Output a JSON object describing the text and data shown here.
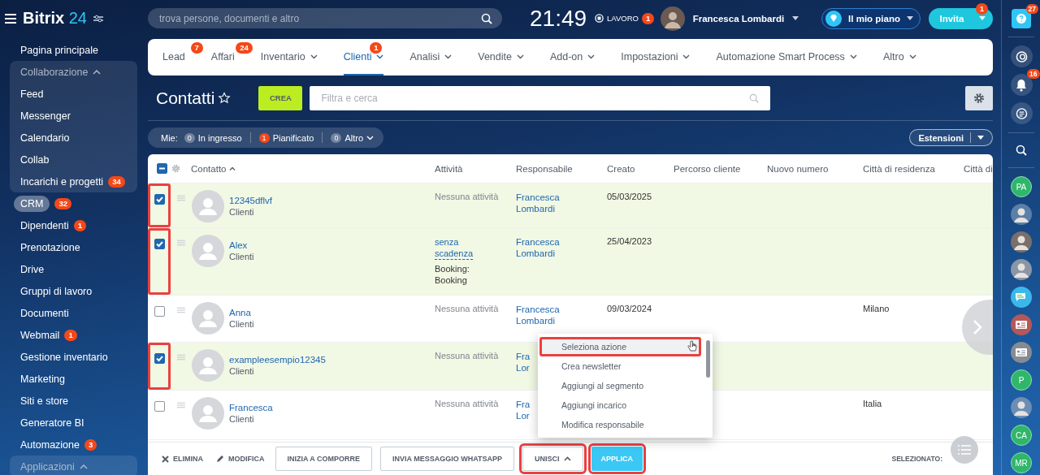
{
  "header": {
    "logo_name": "Bitrix",
    "logo_number": "24",
    "search_placeholder": "trova persone, documenti e altro",
    "clock": "21:49",
    "work_status": "LAVORO",
    "work_badge": "1",
    "user_name": "Francesca Lombardi",
    "plan_button": "Il mio piano",
    "invite_button": "Invita",
    "invite_badge": "1"
  },
  "sidebar": {
    "items": [
      {
        "kind": "link",
        "label": "Pagina principale",
        "selected": false
      },
      {
        "kind": "group",
        "label": "Collaborazione",
        "expanded": true,
        "children": [
          {
            "label": "Feed",
            "selected": false
          },
          {
            "label": "Messenger",
            "selected": false
          },
          {
            "label": "Calendario",
            "selected": false
          },
          {
            "label": "Collab",
            "selected": false
          },
          {
            "label": "Incarichi e progetti",
            "badge": "34",
            "selected": false
          }
        ]
      },
      {
        "kind": "link",
        "label": "CRM",
        "badge": "32",
        "selected": true
      },
      {
        "kind": "link",
        "label": "Dipendenti",
        "badge": "1",
        "selected": false
      },
      {
        "kind": "link",
        "label": "Prenotazione",
        "selected": false
      },
      {
        "kind": "link",
        "label": "Drive",
        "selected": false
      },
      {
        "kind": "link",
        "label": "Gruppi di lavoro",
        "selected": false
      },
      {
        "kind": "link",
        "label": "Documenti",
        "selected": false
      },
      {
        "kind": "link",
        "label": "Webmail",
        "badge": "1",
        "selected": false
      },
      {
        "kind": "link",
        "label": "Gestione inventario",
        "selected": false
      },
      {
        "kind": "link",
        "label": "Marketing",
        "selected": false
      },
      {
        "kind": "link",
        "label": "Siti e store",
        "selected": false
      },
      {
        "kind": "link",
        "label": "Generatore BI",
        "selected": false
      },
      {
        "kind": "link",
        "label": "Automazione",
        "badge": "3",
        "selected": false
      },
      {
        "kind": "group",
        "label": "Applicazioni",
        "expanded": true
      }
    ]
  },
  "nav_tabs": [
    {
      "label": "Lead",
      "badge": "7",
      "dropdown": false,
      "selected": false
    },
    {
      "label": "Affari",
      "badge": "24",
      "dropdown": false,
      "selected": false
    },
    {
      "label": "Inventario",
      "dropdown": true,
      "selected": false
    },
    {
      "label": "Clienti",
      "badge": "1",
      "dropdown": true,
      "selected": true
    },
    {
      "label": "Analisi",
      "dropdown": true,
      "selected": false
    },
    {
      "label": "Vendite",
      "dropdown": true,
      "selected": false
    },
    {
      "label": "Add-on",
      "dropdown": true,
      "selected": false
    },
    {
      "label": "Impostazioni",
      "dropdown": true,
      "selected": false
    },
    {
      "label": "Automazione Smart Process",
      "dropdown": true,
      "selected": false
    },
    {
      "label": "Altro",
      "dropdown": true,
      "selected": false
    }
  ],
  "page": {
    "title": "Contatti",
    "create_button": "CREA",
    "filter_placeholder": "Filtra e cerca"
  },
  "counters": {
    "label": "Mie:",
    "items": [
      {
        "count": "0",
        "label": "In ingresso",
        "alert": false,
        "dropdown": false
      },
      {
        "count": "1",
        "label": "Pianificato",
        "alert": true,
        "dropdown": false
      },
      {
        "count": "0",
        "label": "Altro",
        "alert": false,
        "dropdown": true
      }
    ],
    "extensions_button": "Estensioni"
  },
  "table": {
    "header_checkbox": {
      "indeterminate": true
    },
    "columns": [
      "Contatto",
      "Attività",
      "Responsabile",
      "Creato",
      "Percorso cliente",
      "Nuovo numero",
      "Città di residenza",
      "Città di"
    ],
    "rows": [
      {
        "checked": true,
        "highlighted": true,
        "name": "12345dflvf",
        "type": "Clienti",
        "activity": {
          "kind": "none",
          "text": "Nessuna attività"
        },
        "responsible": "Francesca Lombardi",
        "created": "05/03/2025"
      },
      {
        "checked": true,
        "highlighted": true,
        "name": "Alex",
        "type": "Clienti",
        "activity": {
          "kind": "deadline",
          "deadline": "senza scadenza",
          "note": "Booking: Booking"
        },
        "responsible": "Francesca Lombardi",
        "created": "25/04/2023"
      },
      {
        "checked": false,
        "highlighted": false,
        "name": "Anna",
        "type": "Clienti",
        "activity": {
          "kind": "none",
          "text": "Nessuna attività"
        },
        "responsible": "Francesca Lombardi",
        "created": "09/03/2024",
        "city": "Milano"
      },
      {
        "checked": true,
        "highlighted": true,
        "name": "exampleesempio12345",
        "type": "Clienti",
        "activity": {
          "kind": "none",
          "text": "Nessuna attività"
        },
        "responsible": "Fra Lor"
      },
      {
        "checked": false,
        "highlighted": false,
        "name": "Francesca",
        "type": "Clienti",
        "activity": {
          "kind": "none",
          "text": "Nessuna attività"
        },
        "responsible": "Fra Lor",
        "city": "Italia"
      }
    ]
  },
  "action_menu": {
    "items": [
      {
        "label": "Seleziona azione",
        "highlighted": true
      },
      {
        "label": "Crea newsletter",
        "highlighted": false
      },
      {
        "label": "Aggiungi al segmento",
        "highlighted": false
      },
      {
        "label": "Aggiungi incarico",
        "highlighted": false
      },
      {
        "label": "Modifica responsabile",
        "highlighted": false
      }
    ]
  },
  "bottom_bar": {
    "actions": [
      {
        "kind": "delete",
        "label": "ELIMINA",
        "highlighted": false
      },
      {
        "kind": "edit",
        "label": "MODIFICA",
        "highlighted": false
      },
      {
        "kind": "outline",
        "label": "INIZIA A COMPORRE",
        "highlighted": false
      },
      {
        "kind": "outline",
        "label": "INVIA MESSAGGIO WHATSAPP",
        "highlighted": false
      },
      {
        "kind": "dropdown",
        "label": "UNISCI",
        "highlighted": true
      },
      {
        "kind": "primary",
        "label": "APPLICA",
        "highlighted": true
      }
    ],
    "selected_label": "SELEZIONATO:"
  },
  "right_bar": {
    "help_badge": "27",
    "notifications_badge": "16",
    "contacts": [
      {
        "kind": "initials",
        "initials": "PA",
        "color": "#2fb66a"
      },
      {
        "kind": "photo",
        "color": "#5a7fa8"
      },
      {
        "kind": "photo",
        "color": "#7a6f6a"
      },
      {
        "kind": "photo",
        "color": "#8a96a6"
      },
      {
        "kind": "chat",
        "color": "#3bb8ea"
      },
      {
        "kind": "card",
        "color": "#b4585a"
      },
      {
        "kind": "card",
        "color": "#868b92"
      },
      {
        "kind": "initials",
        "initials": "P",
        "color": "#2fb66a"
      },
      {
        "kind": "photo",
        "color": "#6d8db5"
      },
      {
        "kind": "initials",
        "initials": "CA",
        "color": "#2fb66a"
      },
      {
        "kind": "initials",
        "initials": "MR",
        "color": "#2fb66a"
      }
    ]
  }
}
